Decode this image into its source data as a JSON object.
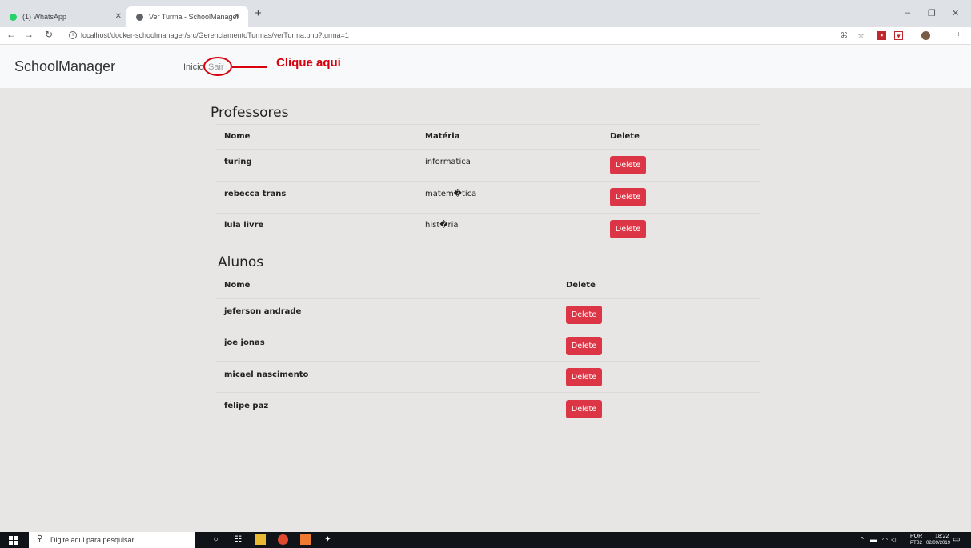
{
  "browser": {
    "tabs": [
      {
        "title": "(1) WhatsApp",
        "favicon": "whatsapp-icon",
        "color": "#25d366"
      },
      {
        "title": "Ver Turma - SchoolManager",
        "favicon": "globe-icon",
        "color": "#5f6368"
      }
    ],
    "new_tab": "+",
    "address": "localhost/docker-schoolmanager/src/GerenciamentoTurmas/verTurma.php?turma=1",
    "window_controls": [
      "–",
      "❐",
      "✕"
    ]
  },
  "header": {
    "brand": "SchoolManager",
    "nav": {
      "inicio": "Inicio",
      "sair": "Sair"
    },
    "annotation": "Clique aqui"
  },
  "professores": {
    "title": "Professores",
    "columns": [
      "Nome",
      "Matéria",
      "Delete"
    ],
    "rows": [
      {
        "nome": "turing",
        "materia": "informatica",
        "action": "Delete"
      },
      {
        "nome": "rebecca trans",
        "materia": "matem�tica",
        "action": "Delete"
      },
      {
        "nome": "lula livre",
        "materia": "hist�ria",
        "action": "Delete"
      }
    ]
  },
  "alunos": {
    "title": "Alunos",
    "columns": [
      "Nome",
      "Delete"
    ],
    "rows": [
      {
        "nome": "jeferson andrade",
        "action": "Delete"
      },
      {
        "nome": "joe jonas",
        "action": "Delete"
      },
      {
        "nome": "micael nascimento",
        "action": "Delete"
      },
      {
        "nome": "felipe paz",
        "action": "Delete"
      }
    ]
  },
  "taskbar": {
    "search_placeholder": "Digite aqui para pesquisar",
    "lang_top": "POR",
    "lang_bottom": "PTB2",
    "time": "18:22",
    "date": "02/09/2019"
  },
  "colors": {
    "delete_button": "#dc3545",
    "annotation": "#d8000c",
    "page_bg": "#e8e6e4"
  }
}
